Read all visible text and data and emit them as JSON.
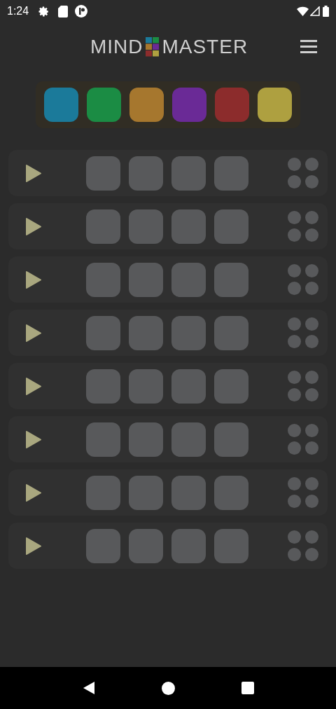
{
  "status_bar": {
    "time": "1:24"
  },
  "header": {
    "logo": [
      "MIND",
      "MASTER"
    ]
  },
  "palette": [
    {
      "color": "#1b7a9a"
    },
    {
      "color": "#1b8c44"
    },
    {
      "color": "#a6772e"
    },
    {
      "color": "#6a2a96"
    },
    {
      "color": "#8c2c2c"
    },
    {
      "color": "#aea040"
    }
  ],
  "rows": [
    {
      "slots": [
        {
          "kind": "empty"
        },
        {
          "kind": "empty"
        },
        {
          "kind": "empty"
        },
        {
          "kind": "empty"
        }
      ],
      "pegs": [
        {
          "kind": "empty"
        },
        {
          "kind": "empty"
        },
        {
          "kind": "empty"
        },
        {
          "kind": "empty"
        }
      ]
    },
    {
      "slots": [
        {
          "kind": "empty"
        },
        {
          "kind": "empty"
        },
        {
          "kind": "empty"
        },
        {
          "kind": "empty"
        }
      ],
      "pegs": [
        {
          "kind": "empty"
        },
        {
          "kind": "empty"
        },
        {
          "kind": "empty"
        },
        {
          "kind": "empty"
        }
      ]
    },
    {
      "slots": [
        {
          "kind": "empty"
        },
        {
          "kind": "empty"
        },
        {
          "kind": "empty"
        },
        {
          "kind": "empty"
        }
      ],
      "pegs": [
        {
          "kind": "empty"
        },
        {
          "kind": "empty"
        },
        {
          "kind": "empty"
        },
        {
          "kind": "empty"
        }
      ]
    },
    {
      "slots": [
        {
          "kind": "empty"
        },
        {
          "kind": "empty"
        },
        {
          "kind": "empty"
        },
        {
          "kind": "empty"
        }
      ],
      "pegs": [
        {
          "kind": "empty"
        },
        {
          "kind": "empty"
        },
        {
          "kind": "empty"
        },
        {
          "kind": "empty"
        }
      ]
    },
    {
      "slots": [
        {
          "kind": "empty"
        },
        {
          "kind": "empty"
        },
        {
          "kind": "empty"
        },
        {
          "kind": "empty"
        }
      ],
      "pegs": [
        {
          "kind": "empty"
        },
        {
          "kind": "empty"
        },
        {
          "kind": "empty"
        },
        {
          "kind": "empty"
        }
      ]
    },
    {
      "slots": [
        {
          "kind": "empty"
        },
        {
          "kind": "empty"
        },
        {
          "kind": "empty"
        },
        {
          "kind": "empty"
        }
      ],
      "pegs": [
        {
          "kind": "empty"
        },
        {
          "kind": "empty"
        },
        {
          "kind": "empty"
        },
        {
          "kind": "empty"
        }
      ]
    },
    {
      "slots": [
        {
          "kind": "empty"
        },
        {
          "kind": "empty"
        },
        {
          "kind": "empty"
        },
        {
          "kind": "empty"
        }
      ],
      "pegs": [
        {
          "kind": "empty"
        },
        {
          "kind": "empty"
        },
        {
          "kind": "empty"
        },
        {
          "kind": "empty"
        }
      ]
    },
    {
      "slots": [
        {
          "kind": "empty"
        },
        {
          "kind": "empty"
        },
        {
          "kind": "empty"
        },
        {
          "kind": "empty"
        }
      ],
      "pegs": [
        {
          "kind": "empty"
        },
        {
          "kind": "empty"
        },
        {
          "kind": "empty"
        },
        {
          "kind": "empty"
        }
      ]
    }
  ]
}
